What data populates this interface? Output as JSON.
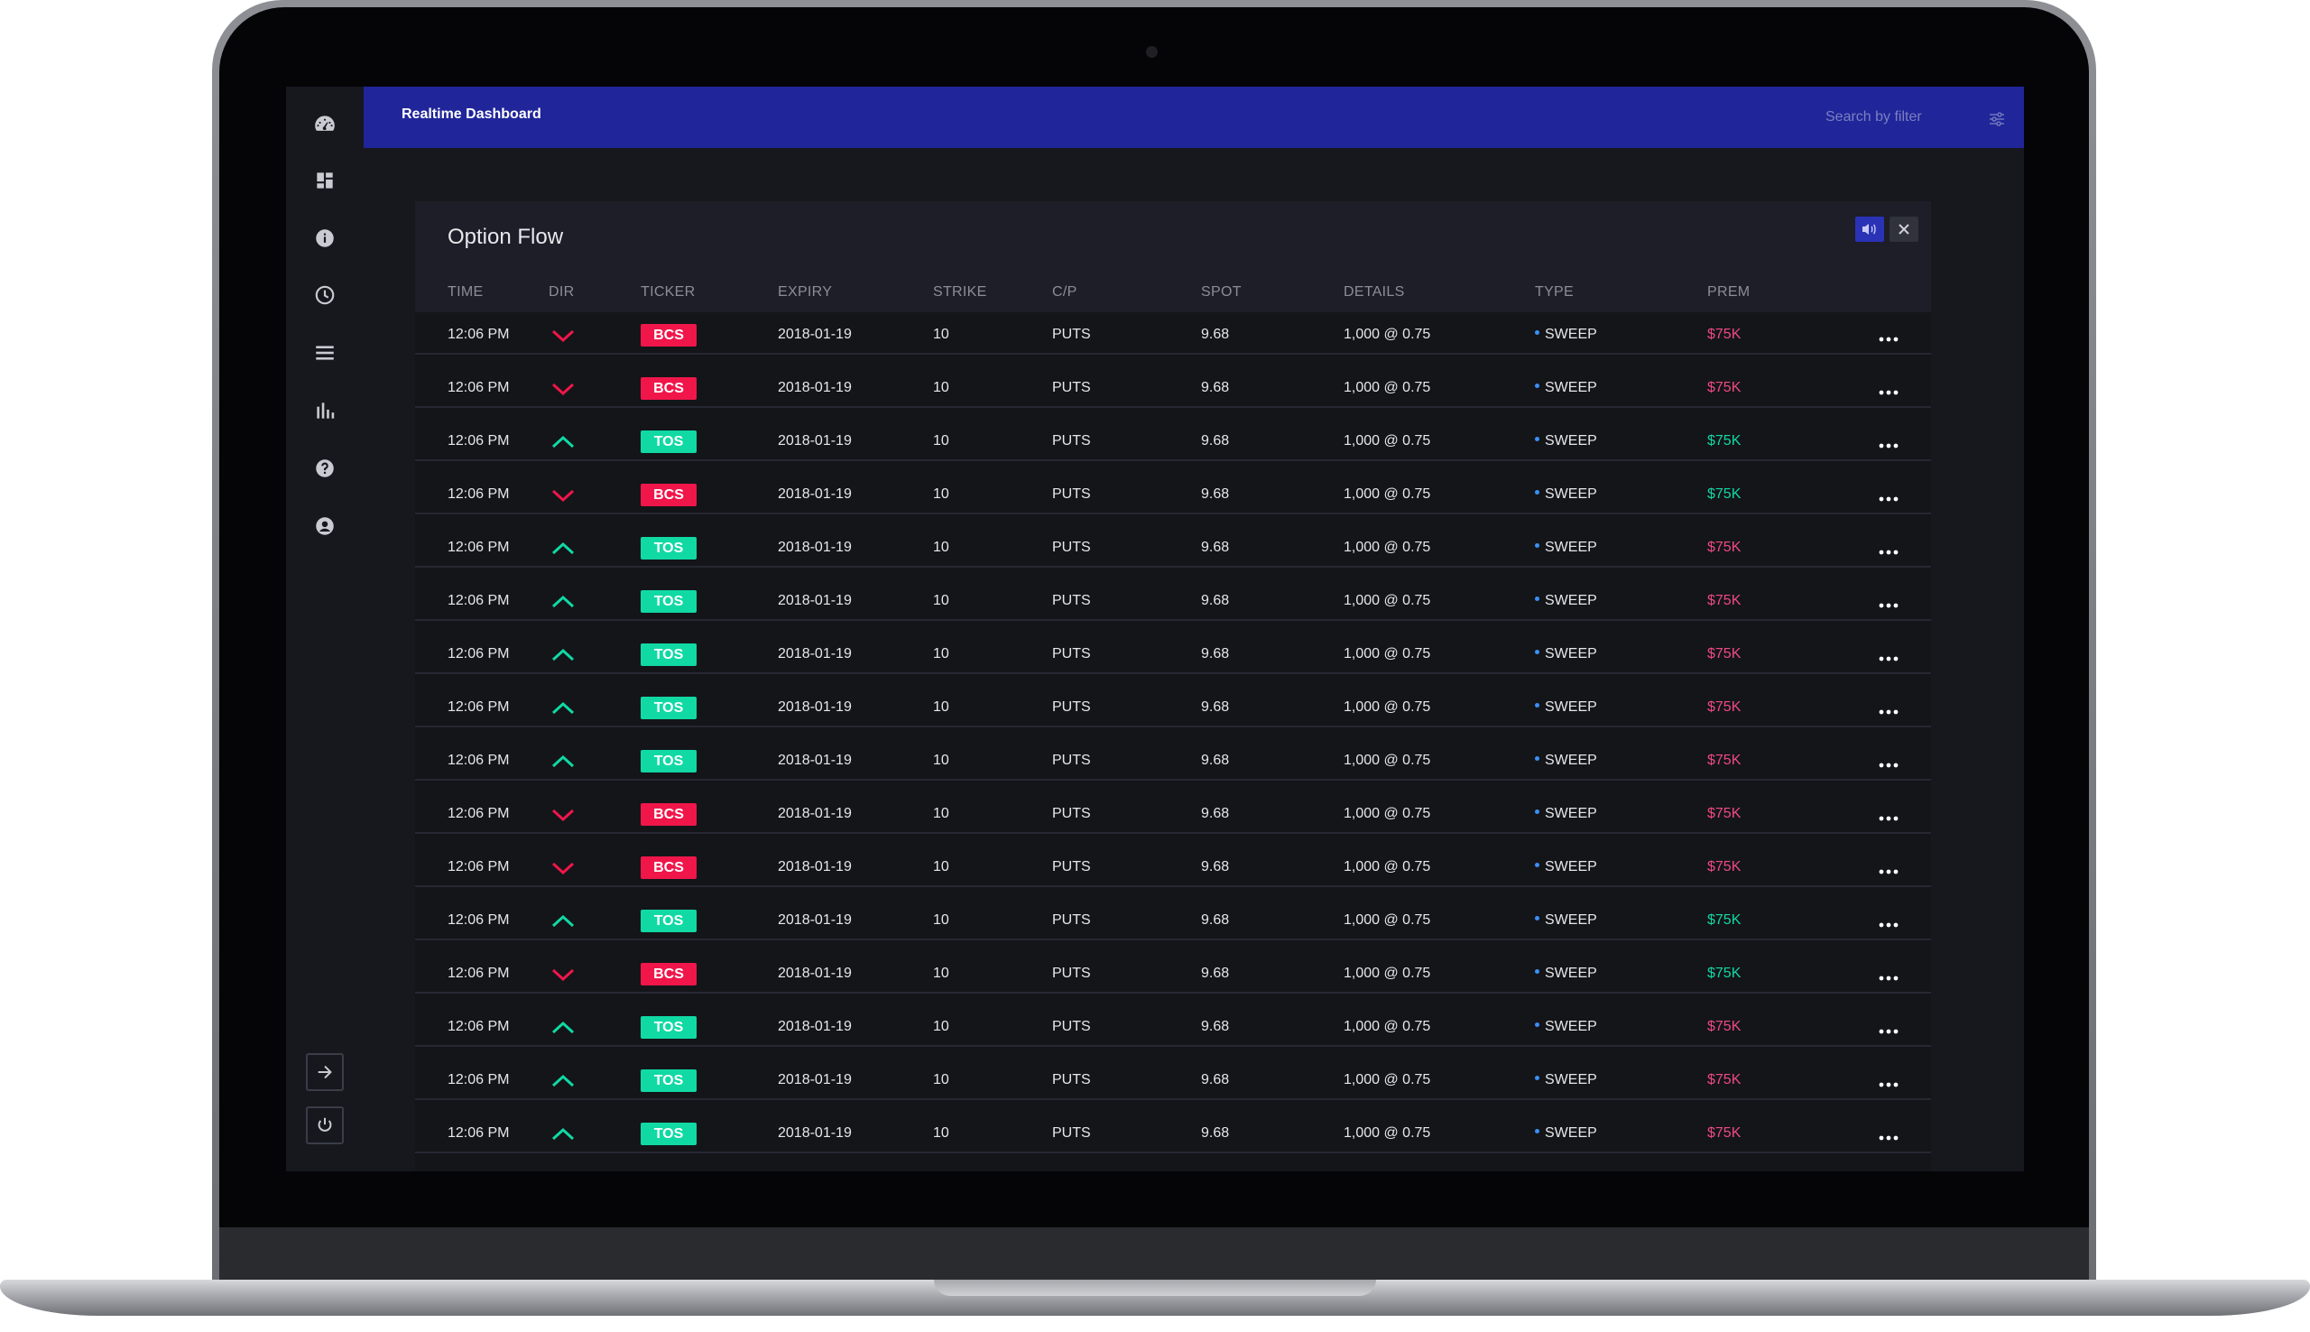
{
  "app": {
    "title": "Realtime Dashboard",
    "search_placeholder": "Search by filter"
  },
  "sidebar": {
    "items": [
      {
        "icon": "speedometer-icon"
      },
      {
        "icon": "grid-icon"
      },
      {
        "icon": "info-icon"
      },
      {
        "icon": "clock-icon"
      },
      {
        "icon": "list-icon"
      },
      {
        "icon": "bar-chart-icon"
      },
      {
        "icon": "help-icon"
      },
      {
        "icon": "account-icon"
      }
    ],
    "bottom": [
      {
        "icon": "arrow-right-icon"
      },
      {
        "icon": "power-icon"
      }
    ]
  },
  "panel": {
    "title": "Option Flow",
    "columns": {
      "time": "TIME",
      "dir": "DIR",
      "ticker": "TICKER",
      "expiry": "EXPIRY",
      "strike": "STRIKE",
      "cp": "C/P",
      "spot": "SPOT",
      "details": "DETAILS",
      "type": "TYPE",
      "prem": "PREM"
    },
    "rows": [
      {
        "time": "12:06 PM",
        "dir": "down",
        "ticker": "BCS",
        "expiry": "2018-01-19",
        "strike": "10",
        "cp": "PUTS",
        "spot": "9.68",
        "details": "1,000 @ 0.75",
        "type": "SWEEP",
        "prem": "$75K",
        "prem_color": "red"
      },
      {
        "time": "12:06 PM",
        "dir": "down",
        "ticker": "BCS",
        "expiry": "2018-01-19",
        "strike": "10",
        "cp": "PUTS",
        "spot": "9.68",
        "details": "1,000 @ 0.75",
        "type": "SWEEP",
        "prem": "$75K",
        "prem_color": "red"
      },
      {
        "time": "12:06 PM",
        "dir": "up",
        "ticker": "TOS",
        "expiry": "2018-01-19",
        "strike": "10",
        "cp": "PUTS",
        "spot": "9.68",
        "details": "1,000 @ 0.75",
        "type": "SWEEP",
        "prem": "$75K",
        "prem_color": "green"
      },
      {
        "time": "12:06 PM",
        "dir": "down",
        "ticker": "BCS",
        "expiry": "2018-01-19",
        "strike": "10",
        "cp": "PUTS",
        "spot": "9.68",
        "details": "1,000 @ 0.75",
        "type": "SWEEP",
        "prem": "$75K",
        "prem_color": "green"
      },
      {
        "time": "12:06 PM",
        "dir": "up",
        "ticker": "TOS",
        "expiry": "2018-01-19",
        "strike": "10",
        "cp": "PUTS",
        "spot": "9.68",
        "details": "1,000 @ 0.75",
        "type": "SWEEP",
        "prem": "$75K",
        "prem_color": "red"
      },
      {
        "time": "12:06 PM",
        "dir": "up",
        "ticker": "TOS",
        "expiry": "2018-01-19",
        "strike": "10",
        "cp": "PUTS",
        "spot": "9.68",
        "details": "1,000 @ 0.75",
        "type": "SWEEP",
        "prem": "$75K",
        "prem_color": "red"
      },
      {
        "time": "12:06 PM",
        "dir": "up",
        "ticker": "TOS",
        "expiry": "2018-01-19",
        "strike": "10",
        "cp": "PUTS",
        "spot": "9.68",
        "details": "1,000 @ 0.75",
        "type": "SWEEP",
        "prem": "$75K",
        "prem_color": "red"
      },
      {
        "time": "12:06 PM",
        "dir": "up",
        "ticker": "TOS",
        "expiry": "2018-01-19",
        "strike": "10",
        "cp": "PUTS",
        "spot": "9.68",
        "details": "1,000 @ 0.75",
        "type": "SWEEP",
        "prem": "$75K",
        "prem_color": "red"
      },
      {
        "time": "12:06 PM",
        "dir": "up",
        "ticker": "TOS",
        "expiry": "2018-01-19",
        "strike": "10",
        "cp": "PUTS",
        "spot": "9.68",
        "details": "1,000 @ 0.75",
        "type": "SWEEP",
        "prem": "$75K",
        "prem_color": "red"
      },
      {
        "time": "12:06 PM",
        "dir": "down",
        "ticker": "BCS",
        "expiry": "2018-01-19",
        "strike": "10",
        "cp": "PUTS",
        "spot": "9.68",
        "details": "1,000 @ 0.75",
        "type": "SWEEP",
        "prem": "$75K",
        "prem_color": "red"
      },
      {
        "time": "12:06 PM",
        "dir": "down",
        "ticker": "BCS",
        "expiry": "2018-01-19",
        "strike": "10",
        "cp": "PUTS",
        "spot": "9.68",
        "details": "1,000 @ 0.75",
        "type": "SWEEP",
        "prem": "$75K",
        "prem_color": "red"
      },
      {
        "time": "12:06 PM",
        "dir": "up",
        "ticker": "TOS",
        "expiry": "2018-01-19",
        "strike": "10",
        "cp": "PUTS",
        "spot": "9.68",
        "details": "1,000 @ 0.75",
        "type": "SWEEP",
        "prem": "$75K",
        "prem_color": "green"
      },
      {
        "time": "12:06 PM",
        "dir": "down",
        "ticker": "BCS",
        "expiry": "2018-01-19",
        "strike": "10",
        "cp": "PUTS",
        "spot": "9.68",
        "details": "1,000 @ 0.75",
        "type": "SWEEP",
        "prem": "$75K",
        "prem_color": "green"
      },
      {
        "time": "12:06 PM",
        "dir": "up",
        "ticker": "TOS",
        "expiry": "2018-01-19",
        "strike": "10",
        "cp": "PUTS",
        "spot": "9.68",
        "details": "1,000 @ 0.75",
        "type": "SWEEP",
        "prem": "$75K",
        "prem_color": "red"
      },
      {
        "time": "12:06 PM",
        "dir": "up",
        "ticker": "TOS",
        "expiry": "2018-01-19",
        "strike": "10",
        "cp": "PUTS",
        "spot": "9.68",
        "details": "1,000 @ 0.75",
        "type": "SWEEP",
        "prem": "$75K",
        "prem_color": "red"
      },
      {
        "time": "12:06 PM",
        "dir": "up",
        "ticker": "TOS",
        "expiry": "2018-01-19",
        "strike": "10",
        "cp": "PUTS",
        "spot": "9.68",
        "details": "1,000 @ 0.75",
        "type": "SWEEP",
        "prem": "$75K",
        "prem_color": "red"
      }
    ]
  },
  "colors": {
    "topbar": "#20259a",
    "up": "#10d9a4",
    "down": "#f0164a",
    "prem_red": "#ef4a80",
    "prem_green": "#10d9a4",
    "type_dot": "#3b8ff7"
  }
}
